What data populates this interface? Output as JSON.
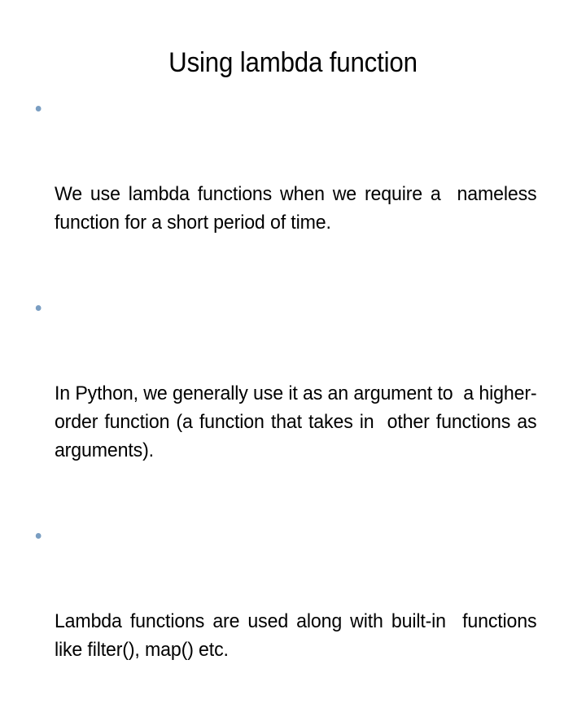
{
  "slide": {
    "background_color": "#ffffff",
    "text_color": "#000000",
    "bullet_color": "#7a9ec2",
    "title": "Using lambda function",
    "bullets": [
      {
        "marker": "bullet-dot",
        "text": "We use lambda functions when we require a  nameless function for a short period of time."
      },
      {
        "marker": "bullet-dot",
        "text": "In Python, we generally use it as an argument to  a higher-order function (a function that takes in  other functions as arguments)."
      },
      {
        "marker": "bullet-dot",
        "text": "Lambda functions are used along with built-in  functions like filter(), map() etc."
      }
    ]
  }
}
